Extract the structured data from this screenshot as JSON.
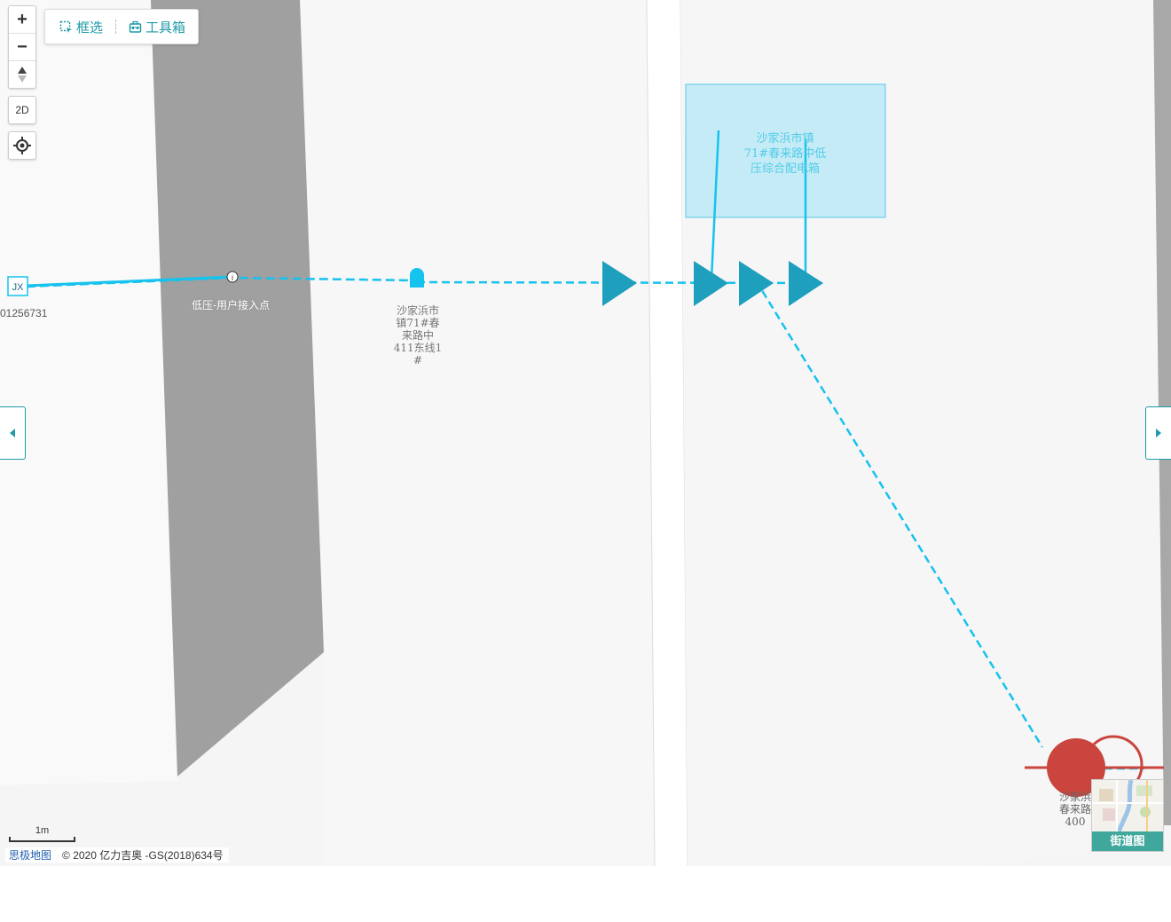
{
  "map": {
    "labels": {
      "left_edge_id": "01256731",
      "access_point": "低压-用户接入点",
      "line_label": [
        "沙家浜市",
        "镇71#春",
        "来路中",
        "411东线1",
        "#"
      ],
      "box_label": [
        "沙家浜市镇",
        "71#春来路中低",
        "压综合配电箱"
      ],
      "red_label": [
        "沙家浜",
        "春来路",
        "400"
      ],
      "jx_marker": "JX",
      "access_marker": "i"
    },
    "colors": {
      "cable": "#16c2ee",
      "arrow": "#1f9fbe",
      "box_fill": "#c5ecf6",
      "building": "#a0a0a0",
      "transformer": "#c9453e",
      "accent": "#1f9aa8"
    }
  },
  "controls": {
    "zoom_in": "+",
    "zoom_out": "−",
    "compass_icon": "compass-icon",
    "mode": "2D",
    "locate_icon": "locate-icon"
  },
  "toolbar": {
    "select_label": "框选",
    "select_icon": "box-select-icon",
    "toolbox_label": "工具箱",
    "toolbox_icon": "toolbox-icon"
  },
  "side": {
    "left_icon": "caret-left-icon",
    "right_icon": "caret-right-icon"
  },
  "scale": {
    "label": "1m"
  },
  "attribution": {
    "brand": "思极地图",
    "copyright": "© 2020 亿力吉奥 -GS(2018)634号"
  },
  "basemap": {
    "label": "街道图"
  }
}
